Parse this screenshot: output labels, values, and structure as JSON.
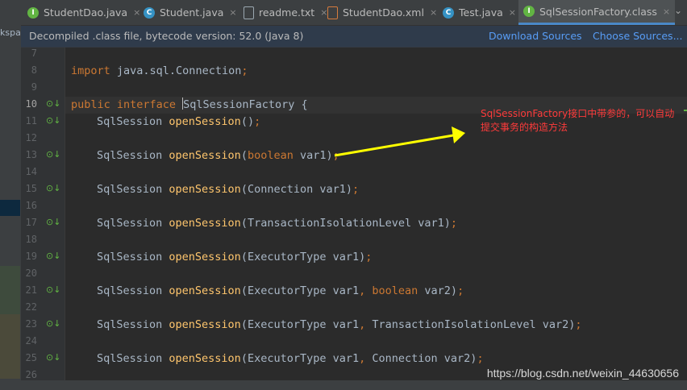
{
  "left_panel": {
    "label": "kspa"
  },
  "tabs": [
    {
      "label": "StudentDao.java",
      "icon": "interface-icon",
      "icon_letter": "I",
      "icon_color": "#62b543",
      "close": "×",
      "active": false
    },
    {
      "label": "Student.java",
      "icon": "class-icon",
      "icon_letter": "C",
      "icon_color": "#3592c4",
      "close": "×",
      "active": false
    },
    {
      "label": "readme.txt",
      "icon": "text-file-icon",
      "icon_letter": "",
      "icon_color": "#9aa7b0",
      "close": "×",
      "active": false
    },
    {
      "label": "StudentDao.xml",
      "icon": "xml-file-icon",
      "icon_letter": "",
      "icon_color": "#d57b3d",
      "close": "×",
      "active": false
    },
    {
      "label": "Test.java",
      "icon": "class-icon",
      "icon_letter": "C",
      "icon_color": "#3592c4",
      "close": "×",
      "active": false
    },
    {
      "label": "SqlSessionFactory.class",
      "icon": "interface-icon",
      "icon_letter": "I",
      "icon_color": "#62b543",
      "close": "×",
      "active": true
    }
  ],
  "tab_overflow": "⌄",
  "banner": {
    "text": "Decompiled .class file, bytecode version: 52.0 (Java 8)",
    "download_sources": "Download Sources",
    "choose_sources": "Choose Sources..."
  },
  "editor": {
    "lines": [
      {
        "num": "7",
        "impl": false,
        "code": []
      },
      {
        "num": "8",
        "impl": false,
        "code": [
          {
            "t": "import ",
            "c": "kw"
          },
          {
            "t": "java.sql.Connection",
            "c": "ty"
          },
          {
            "t": ";",
            "c": "kw"
          }
        ]
      },
      {
        "num": "9",
        "impl": false,
        "code": []
      },
      {
        "num": "10",
        "impl": true,
        "current": true,
        "code": [
          {
            "t": "public interface ",
            "c": "kw"
          },
          {
            "t": "|caret|",
            "c": "caret"
          },
          {
            "t": "SqlSessionFactory ",
            "c": "ty"
          },
          {
            "t": "{",
            "c": "pu"
          }
        ]
      },
      {
        "num": "11",
        "impl": true,
        "code": [
          {
            "t": "    ",
            "c": "ind"
          },
          {
            "t": "SqlSession ",
            "c": "ty"
          },
          {
            "t": "openSession",
            "c": "fn"
          },
          {
            "t": "()",
            "c": "pu"
          },
          {
            "t": ";",
            "c": "kw"
          }
        ]
      },
      {
        "num": "12",
        "impl": false,
        "code": []
      },
      {
        "num": "13",
        "impl": true,
        "code": [
          {
            "t": "    ",
            "c": "ind"
          },
          {
            "t": "SqlSession ",
            "c": "ty"
          },
          {
            "t": "openSession",
            "c": "fn"
          },
          {
            "t": "(",
            "c": "pu"
          },
          {
            "t": "boolean ",
            "c": "kw"
          },
          {
            "t": "var1)",
            "c": "ar"
          },
          {
            "t": ";",
            "c": "kw"
          }
        ]
      },
      {
        "num": "14",
        "impl": false,
        "code": []
      },
      {
        "num": "15",
        "impl": true,
        "code": [
          {
            "t": "    ",
            "c": "ind"
          },
          {
            "t": "SqlSession ",
            "c": "ty"
          },
          {
            "t": "openSession",
            "c": "fn"
          },
          {
            "t": "(Connection var1)",
            "c": "ar"
          },
          {
            "t": ";",
            "c": "kw"
          }
        ]
      },
      {
        "num": "16",
        "impl": false,
        "code": []
      },
      {
        "num": "17",
        "impl": true,
        "code": [
          {
            "t": "    ",
            "c": "ind"
          },
          {
            "t": "SqlSession ",
            "c": "ty"
          },
          {
            "t": "openSession",
            "c": "fn"
          },
          {
            "t": "(TransactionIsolationLevel var1)",
            "c": "ar"
          },
          {
            "t": ";",
            "c": "kw"
          }
        ]
      },
      {
        "num": "18",
        "impl": false,
        "code": []
      },
      {
        "num": "19",
        "impl": true,
        "code": [
          {
            "t": "    ",
            "c": "ind"
          },
          {
            "t": "SqlSession ",
            "c": "ty"
          },
          {
            "t": "openSession",
            "c": "fn"
          },
          {
            "t": "(ExecutorType var1)",
            "c": "ar"
          },
          {
            "t": ";",
            "c": "kw"
          }
        ]
      },
      {
        "num": "20",
        "impl": false,
        "code": []
      },
      {
        "num": "21",
        "impl": true,
        "code": [
          {
            "t": "    ",
            "c": "ind"
          },
          {
            "t": "SqlSession ",
            "c": "ty"
          },
          {
            "t": "openSession",
            "c": "fn"
          },
          {
            "t": "(ExecutorType var1",
            "c": "ar"
          },
          {
            "t": ", ",
            "c": "kw"
          },
          {
            "t": "boolean ",
            "c": "kw"
          },
          {
            "t": "var2)",
            "c": "ar"
          },
          {
            "t": ";",
            "c": "kw"
          }
        ]
      },
      {
        "num": "22",
        "impl": false,
        "code": []
      },
      {
        "num": "23",
        "impl": true,
        "code": [
          {
            "t": "    ",
            "c": "ind"
          },
          {
            "t": "SqlSession ",
            "c": "ty"
          },
          {
            "t": "openSession",
            "c": "fn"
          },
          {
            "t": "(ExecutorType var1",
            "c": "ar"
          },
          {
            "t": ", ",
            "c": "kw"
          },
          {
            "t": "TransactionIsolationLevel var2)",
            "c": "ar"
          },
          {
            "t": ";",
            "c": "kw"
          }
        ]
      },
      {
        "num": "24",
        "impl": false,
        "code": []
      },
      {
        "num": "25",
        "impl": true,
        "code": [
          {
            "t": "    ",
            "c": "ind"
          },
          {
            "t": "SqlSession ",
            "c": "ty"
          },
          {
            "t": "openSession",
            "c": "fn"
          },
          {
            "t": "(ExecutorType var1",
            "c": "ar"
          },
          {
            "t": ", ",
            "c": "kw"
          },
          {
            "t": "Connection var2)",
            "c": "ar"
          },
          {
            "t": ";",
            "c": "kw"
          }
        ]
      },
      {
        "num": "26",
        "impl": false,
        "code": []
      }
    ],
    "impl_icon": "⊙↓"
  },
  "annotation": {
    "text": "SqlSessionFactory接口中带参的，可以自动提交事务的构造方法",
    "color": "#ff3b3b",
    "arrow_color": "#ffff00"
  },
  "watermark": "https://blog.csdn.net/weixin_44630656"
}
